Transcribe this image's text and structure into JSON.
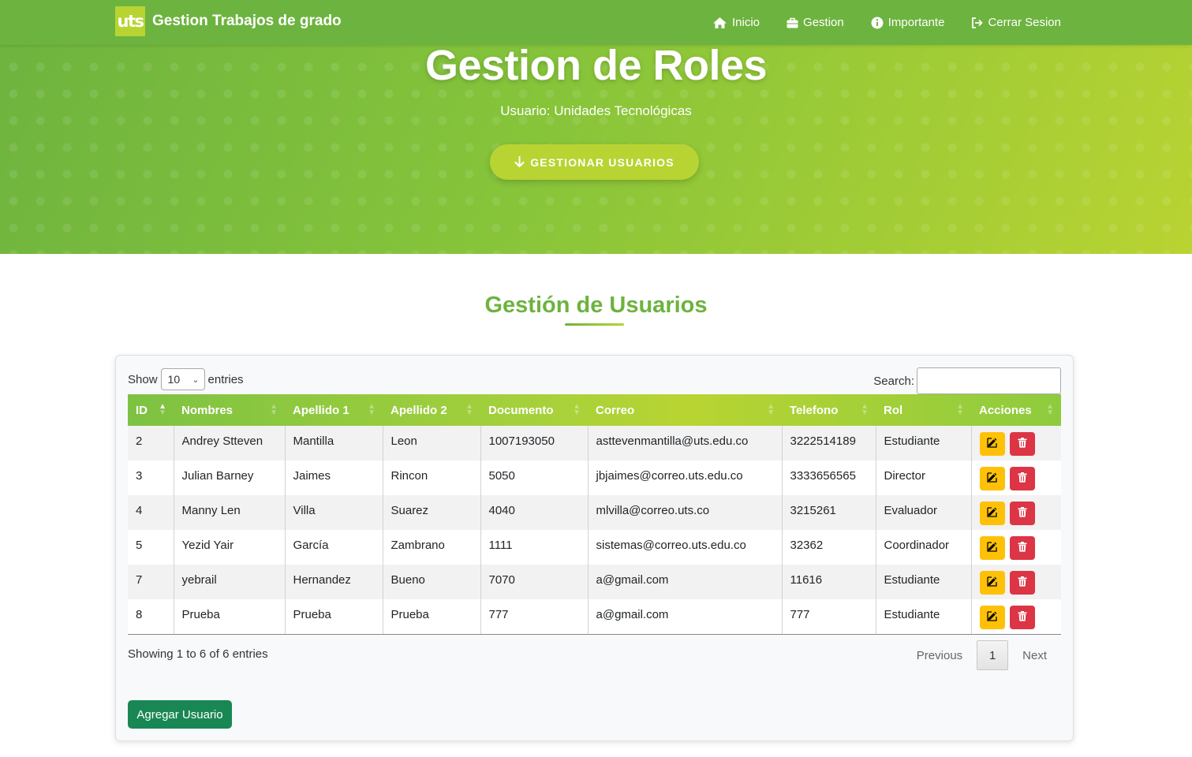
{
  "navbar": {
    "logo_text": "uts",
    "brand": "Gestion Trabajos de grado",
    "links": [
      {
        "label": "Inicio",
        "icon": "home-icon"
      },
      {
        "label": "Gestion",
        "icon": "briefcase-icon"
      },
      {
        "label": "Importante",
        "icon": "info-icon"
      },
      {
        "label": "Cerrar Sesion",
        "icon": "sign-out-icon"
      }
    ]
  },
  "hero": {
    "title": "Gestion de Roles",
    "subtitle": "Usuario: Unidades Tecnológicas",
    "button_label": "GESTIONAR USUARIOS"
  },
  "section": {
    "title": "Gestión de Usuarios"
  },
  "table_controls": {
    "show_label": "Show",
    "entries_value": "10",
    "entries_label": "entries",
    "search_label": "Search:",
    "search_value": ""
  },
  "table": {
    "columns": [
      "ID",
      "Nombres",
      "Apellido 1",
      "Apellido 2",
      "Documento",
      "Correo",
      "Telefono",
      "Rol",
      "Acciones"
    ],
    "rows": [
      [
        "2",
        "Andrey Stteven",
        "Mantilla",
        "Leon",
        "1007193050",
        "asttevenmantilla@uts.edu.co",
        "3222514189",
        "Estudiante"
      ],
      [
        "3",
        "Julian Barney",
        "Jaimes",
        "Rincon",
        "5050",
        "jbjaimes@correo.uts.edu.co",
        "3333656565",
        "Director"
      ],
      [
        "4",
        "Manny Len",
        "Villa",
        "Suarez",
        "4040",
        "mlvilla@correo.uts.co",
        "3215261",
        "Evaluador"
      ],
      [
        "5",
        "Yezid Yair",
        "García",
        "Zambrano",
        "1111",
        "sistemas@correo.uts.edu.co",
        "32362",
        "Coordinador"
      ],
      [
        "7",
        "yebrail",
        "Hernandez",
        "Bueno",
        "7070",
        "a@gmail.com",
        "11616",
        "Estudiante"
      ],
      [
        "8",
        "Prueba",
        "Prueba",
        "Prueba",
        "777",
        "a@gmail.com",
        "777",
        "Estudiante"
      ]
    ]
  },
  "footer": {
    "info": "Showing 1 to 6 of 6 entries",
    "previous": "Previous",
    "page": "1",
    "next": "Next",
    "add_button": "Agregar Usuario"
  },
  "colors": {
    "primary_green": "#6db33f",
    "lime": "#b8d432",
    "edit_yellow": "#ffc107",
    "delete_red": "#dc3545",
    "add_green": "#198754"
  }
}
